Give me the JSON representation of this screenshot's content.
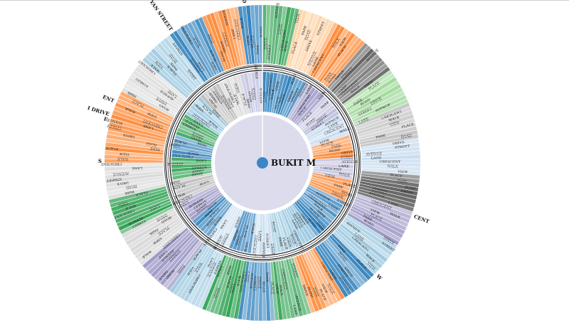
{
  "center": {
    "label": "BUKIT M"
  },
  "palette": [
    "#9ecae1",
    "#3182bd",
    "#fd8d3c",
    "#fdd0a2",
    "#a1d99b",
    "#31a354",
    "#9e9ac8",
    "#bcbddc",
    "#636363",
    "#bdbdbd",
    "#d9d9d9",
    "#c6dbef"
  ],
  "outer_labels": [
    "ROAD",
    "AY YAN STREET",
    "ENT",
    "I DRIVE",
    "CENT",
    "W",
    "E",
    "S"
  ],
  "inner_segment_words": [
    "ROAD",
    "DRIVE",
    "STREET",
    "AVENUE",
    "LANE",
    "CRESCENT",
    "WALK",
    "VIEW",
    "PLACE",
    "PARK"
  ],
  "ring_counts": {
    "outer": 240,
    "inner": 150
  }
}
